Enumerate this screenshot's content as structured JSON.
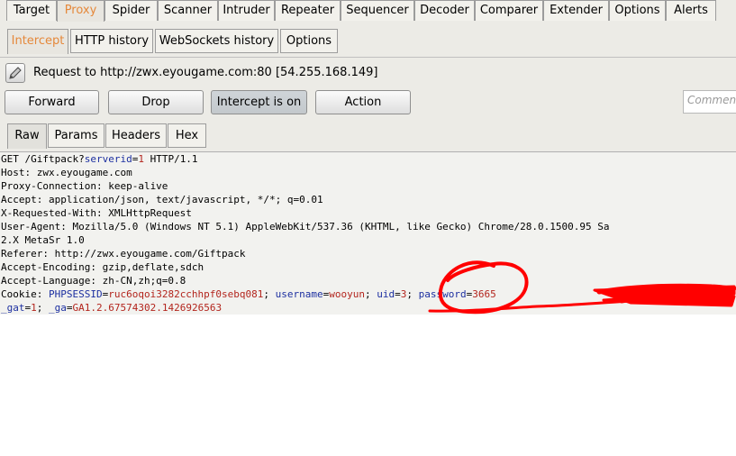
{
  "main_tabs": [
    "Target",
    "Proxy",
    "Spider",
    "Scanner",
    "Intruder",
    "Repeater",
    "Sequencer",
    "Decoder",
    "Comparer",
    "Extender",
    "Options",
    "Alerts"
  ],
  "sub_tabs": [
    "Intercept",
    "HTTP history",
    "WebSockets history",
    "Options"
  ],
  "request_info": "Request to http://zwx.eyougame.com:80  [54.255.168.149]",
  "buttons": {
    "forward": "Forward",
    "drop": "Drop",
    "intercept": "Intercept is on",
    "action": "Action"
  },
  "comment_placeholder": "Comment",
  "view_tabs": [
    "Raw",
    "Params",
    "Headers",
    "Hex"
  ],
  "request": {
    "l1_a": "GET /Giftpack?",
    "l1_param": "serverid",
    "l1_eq": "=",
    "l1_val": "1",
    "l1_b": " HTTP/1.1",
    "host": "Host: zwx.eyougame.com",
    "proxy_conn": "Proxy-Connection: keep-alive",
    "accept": "Accept: application/json, text/javascript, */*; q=0.01",
    "xrw": "X-Requested-With: XMLHttpRequest",
    "ua1": "User-Agent: Mozilla/5.0 (Windows NT 5.1) AppleWebKit/537.36 (KHTML, like Gecko) Chrome/28.0.1500.95 Sa",
    "ua2": "2.X MetaSr 1.0",
    "referer": "Referer: http://zwx.eyougame.com/Giftpack",
    "accept_enc": "Accept-Encoding: gzip,deflate,sdch",
    "accept_lang": "Accept-Language: zh-CN,zh;q=0.8",
    "cookie_label": "Cookie: ",
    "c1n": "PHPSESSID",
    "c1v": "ruc6oqoi3282cchhpf0sebq081",
    "c2n": "username",
    "c2v": "wooyun",
    "c3n": "uid",
    "c3v": "3",
    "c4n": "password",
    "c4v": "3665",
    "c5n": "_gat",
    "c5v": "1",
    "c6n": "_ga",
    "c6v": "GA1.2.67574302.1426926563"
  },
  "colors": {
    "active_tab": "#e5883a",
    "param_name": "#1c2fa0",
    "param_value": "#b3251d",
    "annotation": "#ff0000"
  },
  "icons": {
    "request_icon": "pencil-icon"
  }
}
